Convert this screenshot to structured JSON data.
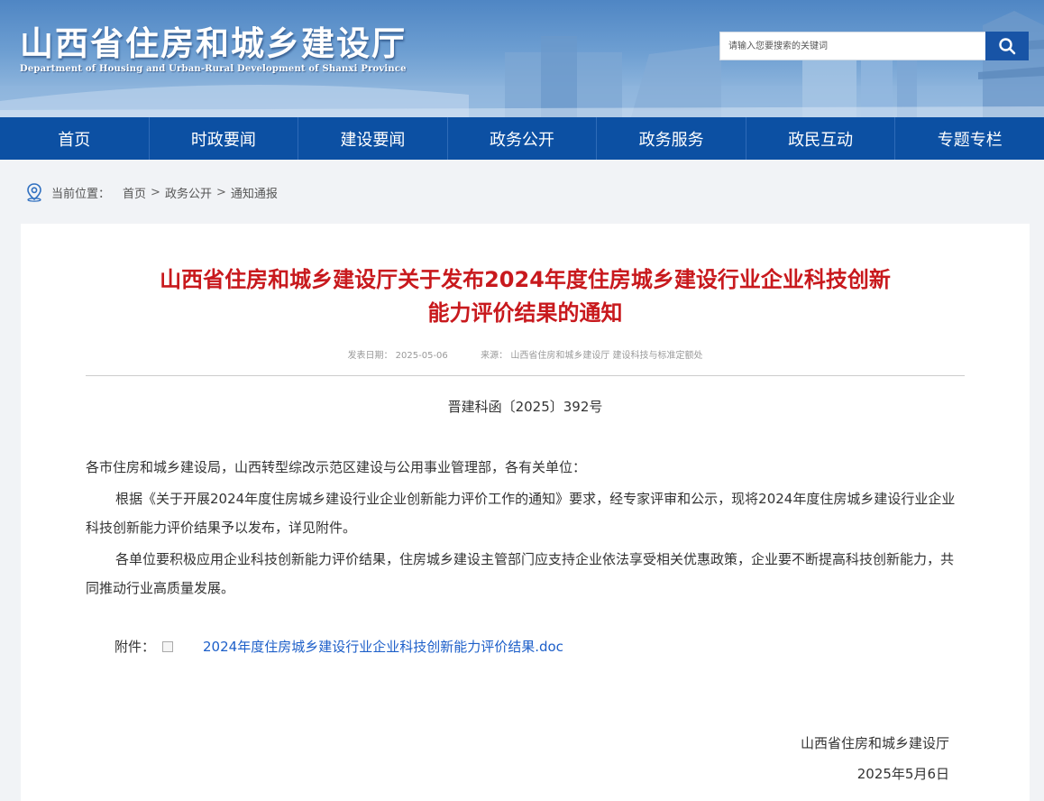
{
  "header": {
    "site_title": "山西省住房和城乡建设厅",
    "site_subtitle": "Department of Housing and Urban-Rural Development of Shanxi Province",
    "search_placeholder": "请输入您要搜索的关键词",
    "search_icon": "search-icon"
  },
  "nav": {
    "items": [
      "首页",
      "时政要闻",
      "建设要闻",
      "政务公开",
      "政务服务",
      "政民互动",
      "专题专栏"
    ]
  },
  "breadcrumb": {
    "icon": "location-pin-icon",
    "label": "当前位置：",
    "items": [
      "首页",
      "政务公开",
      "通知通报"
    ],
    "separator": ">"
  },
  "article": {
    "title_line1": "山西省住房和城乡建设厅关于发布2024年度住房城乡建设行业企业科技创新",
    "title_line2": "能力评价结果的通知",
    "date_label": "发表日期：",
    "date_value": "2025-05-06",
    "source_label": "来源：",
    "source_value": "山西省住房和城乡建设厅 建设科技与标准定额处",
    "doc_number": "晋建科函〔2025〕392号",
    "salutation": "各市住房和城乡建设局，山西转型综改示范区建设与公用事业管理部，各有关单位：",
    "paragraph1": "根据《关于开展2024年度住房城乡建设行业企业创新能力评价工作的通知》要求，经专家评审和公示，现将2024年度住房城乡建设行业企业科技创新能力评价结果予以发布，详见附件。",
    "paragraph2": "各单位要积极应用企业科技创新能力评价结果，住房城乡建设主管部门应支持企业依法享受相关优惠政策，企业要不断提高科技创新能力，共同推动行业高质量发展。",
    "attachment_label": "附件：",
    "attachment_link": "2024年度住房城乡建设行业企业科技创新能力评价结果.doc",
    "signature_org": "山西省住房和城乡建设厅",
    "signature_date": "2025年5月6日"
  },
  "colors": {
    "nav_bg": "#0c50a3",
    "title_red": "#c8191d",
    "link_blue": "#1d5fc9"
  }
}
